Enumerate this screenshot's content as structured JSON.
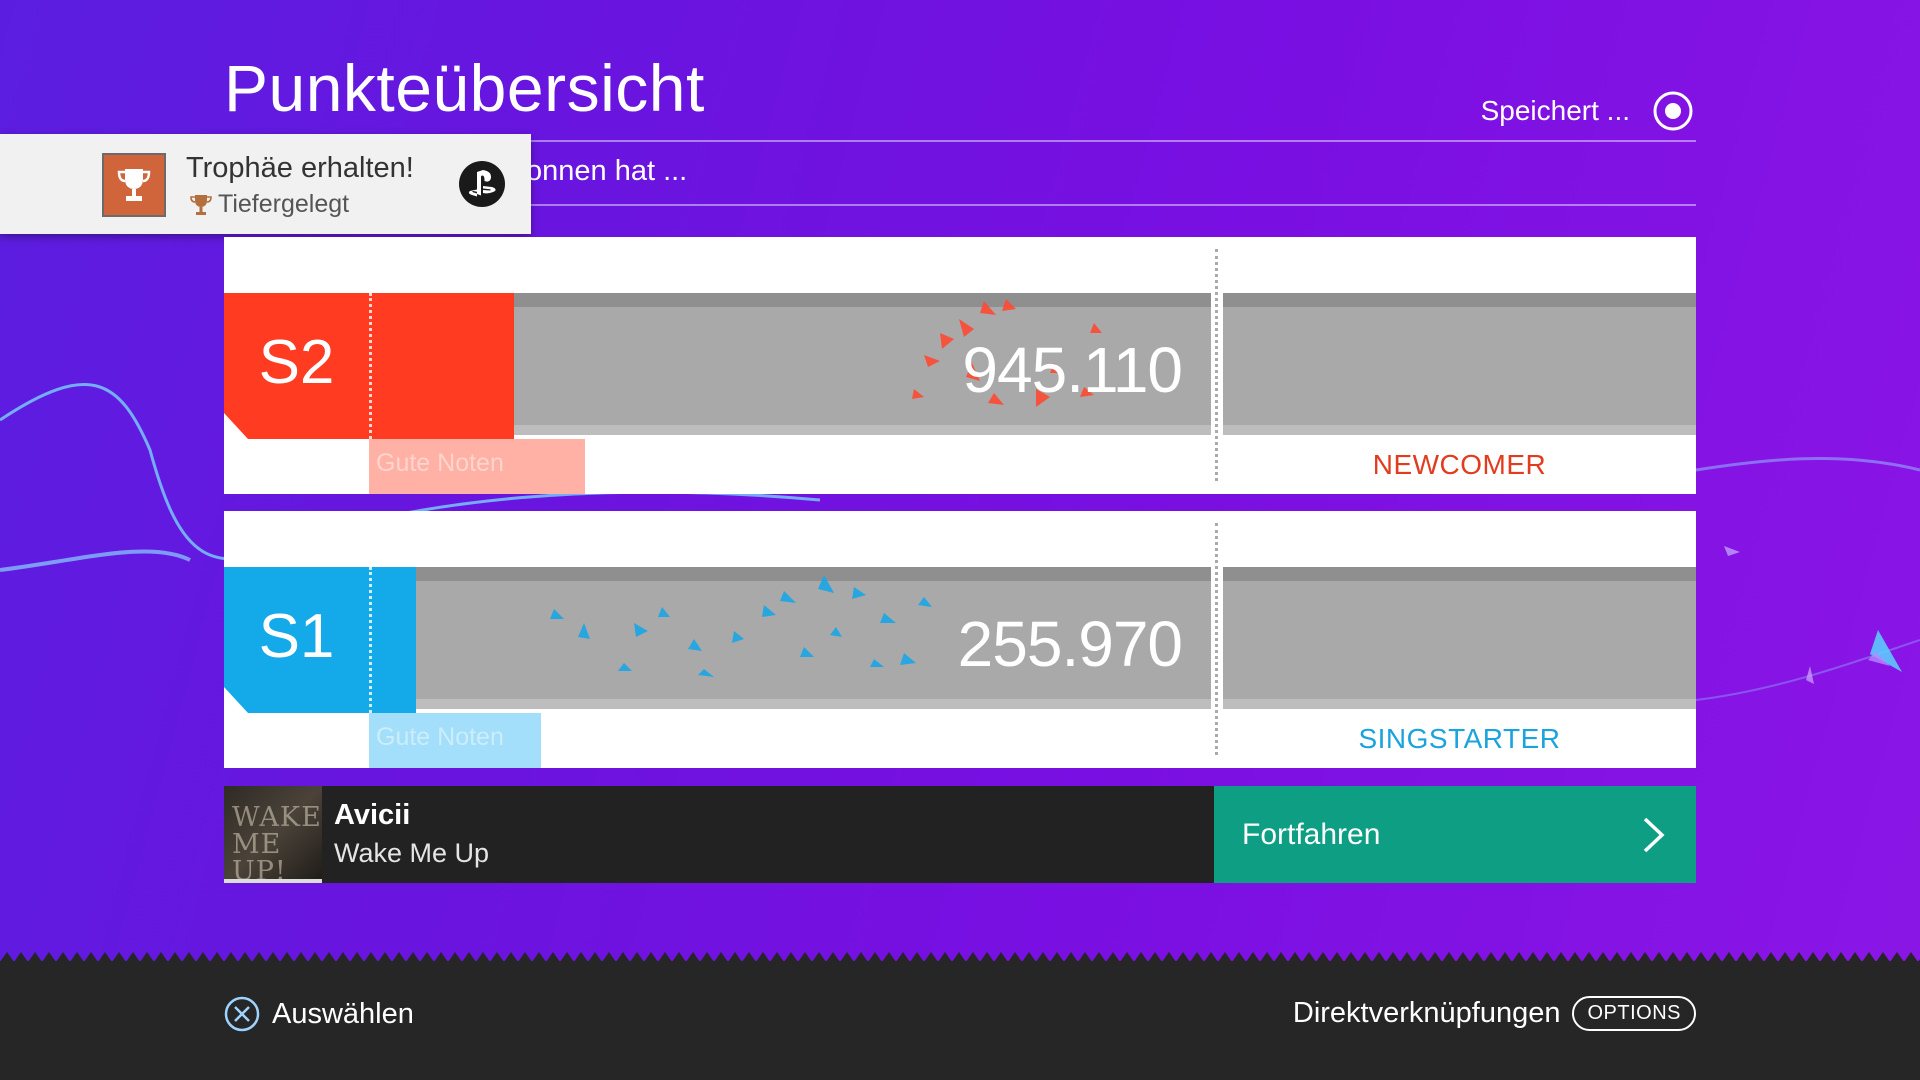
{
  "header": {
    "title": "Punkteübersicht",
    "saving_label": "Speichert ...",
    "subtitle": "onnen hat ..."
  },
  "notification": {
    "title": "Trophäe erhalten!",
    "trophy_name": "Tiefergelegt",
    "icon": "trophy-icon",
    "platform_icon": "playstation-icon"
  },
  "players": [
    {
      "id": "S2",
      "score": "945.110",
      "score_fraction": 0.81,
      "fill_fraction": 0.147,
      "grade": "Gute Noten",
      "rank": "NEWCOMER",
      "color": "#ff3b22",
      "grade_color": "#ffb1a5",
      "rank_color": "#e23c1e"
    },
    {
      "id": "S1",
      "score": "255.970",
      "score_fraction": 0.22,
      "fill_fraction": 0.048,
      "grade": "Gute Noten",
      "rank": "SINGSTARTER",
      "color": "#14aaea",
      "grade_color": "#a3defa",
      "rank_color": "#1aa3dd"
    }
  ],
  "song": {
    "artist": "Avicii",
    "title": "Wake Me Up",
    "album_art_text": "WAKE ME UP!",
    "continue_label": "Fortfahren"
  },
  "footer": {
    "select_label": "Auswählen",
    "select_icon": "cross-button-icon",
    "shortcuts_label": "Direktverknüpfungen",
    "options_label": "OPTIONS"
  },
  "colors": {
    "background": "#7012e0",
    "continue": "#0e9e84",
    "footer": "#262626"
  }
}
